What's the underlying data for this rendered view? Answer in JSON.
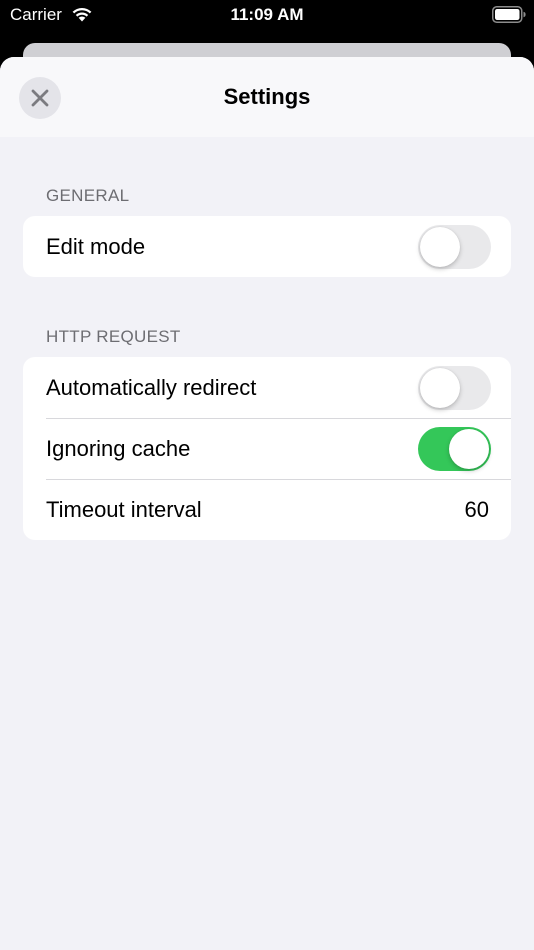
{
  "status_bar": {
    "carrier": "Carrier",
    "time": "11:09 AM",
    "wifi_icon": "wifi-icon",
    "battery_icon": "battery-icon"
  },
  "nav": {
    "title": "Settings",
    "close_icon": "close-icon"
  },
  "sections": {
    "general": {
      "header": "GENERAL",
      "edit_mode": {
        "label": "Edit mode",
        "on": false
      }
    },
    "http_request": {
      "header": "HTTP REQUEST",
      "auto_redirect": {
        "label": "Automatically redirect",
        "on": false
      },
      "ignoring_cache": {
        "label": "Ignoring cache",
        "on": true
      },
      "timeout_interval": {
        "label": "Timeout interval",
        "value": "60"
      }
    }
  },
  "colors": {
    "toggle_on": "#34c759",
    "toggle_off": "#e9e9eb",
    "grouped_background": "#f2f2f7",
    "section_header_text": "#6d6d72"
  }
}
